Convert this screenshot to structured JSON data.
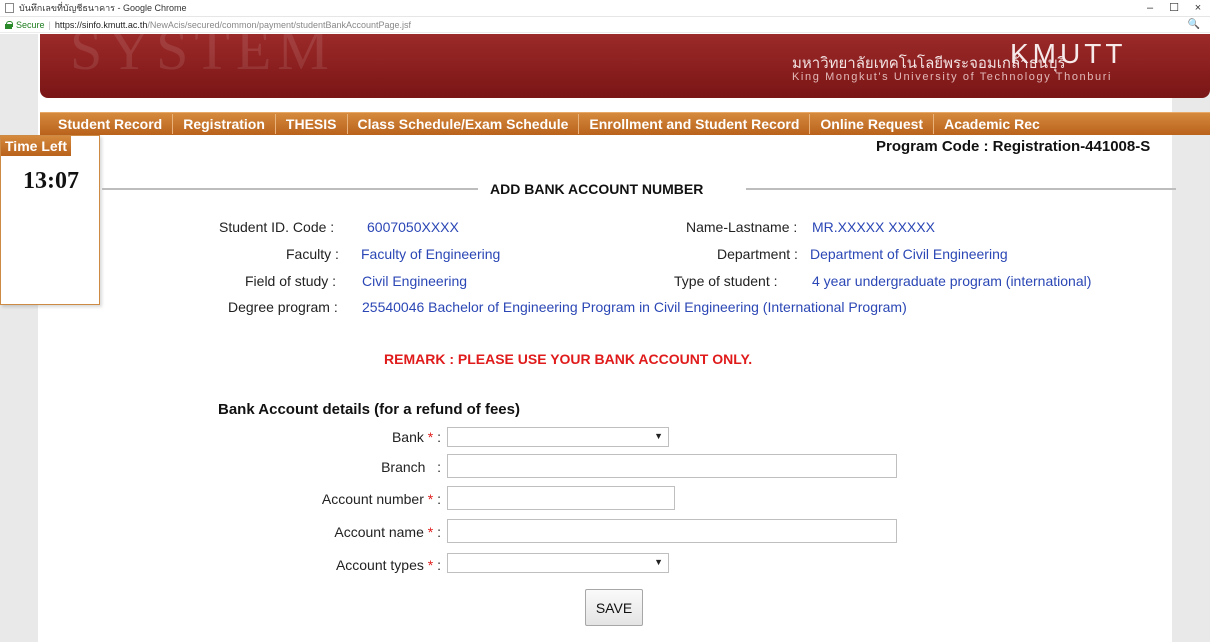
{
  "window": {
    "title": "บันทึกเลขที่บัญชีธนาคาร - Google Chrome",
    "controls": [
      "–",
      "☐",
      "×"
    ]
  },
  "address_bar": {
    "secure_label": "Secure",
    "separator": "|",
    "url_host": "https://sinfo.kmutt.ac.th",
    "url_path": "/NewAcis/secured/common/payment/studentBankAccountPage.jsf",
    "zoom_icon": "🔍"
  },
  "banner": {
    "watermark": "SYSTEM",
    "thai_name": "มหาวิทยาลัยเทคโนโลยีพระจอมเกล้าธนบุรี",
    "acronym": "KMUTT",
    "english_name": "King Mongkut's University of Technology Thonburi"
  },
  "nav": {
    "items": [
      "Student Record",
      "Registration",
      "THESIS",
      "Class Schedule/Exam Schedule",
      "Enrollment and Student Record",
      "Online Request",
      "Academic Rec"
    ]
  },
  "timer": {
    "label": "Time Left",
    "value": "13:07"
  },
  "program_code": "Program Code : Registration-441008-S",
  "section_title": "ADD BANK ACCOUNT NUMBER",
  "student": {
    "id_label": "Student ID. Code :",
    "id_value": "6007050XXXX",
    "name_label": "Name-Lastname :",
    "name_value": "MR.XXXXX  XXXXX",
    "faculty_label": "Faculty :",
    "faculty_value": "Faculty of Engineering",
    "department_label": "Department :",
    "department_value": "Department of Civil Engineering",
    "field_label": "Field of study :",
    "field_value": "Civil Engineering",
    "type_label": "Type of student :",
    "type_value": "4 year undergraduate program (international)",
    "degree_label": "Degree program :",
    "degree_value": "25540046 Bachelor of Engineering Program in Civil Engineering (International Program)"
  },
  "remark": "REMARK : PLEASE USE YOUR BANK ACCOUNT ONLY.",
  "bank_form": {
    "heading": "Bank Account details (for a refund of fees)",
    "bank_label": "Bank",
    "branch_label": "Branch",
    "account_number_label": "Account number",
    "account_name_label": "Account name",
    "account_types_label": "Account types",
    "required_mark": "*",
    "colon": ":",
    "bank_value": "",
    "branch_value": "",
    "account_number_value": "",
    "account_name_value": "",
    "account_types_value": "",
    "dropdown_arrow": "▼",
    "save_label": "SAVE"
  }
}
